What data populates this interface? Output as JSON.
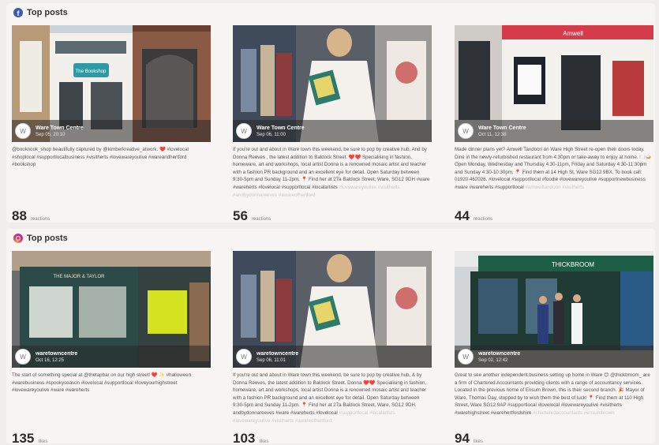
{
  "sections": [
    {
      "title": "Top posts",
      "platform_icon": "facebook-icon",
      "posts": [
        {
          "avatar": "W",
          "account": "Ware Town Centre",
          "date": "Sep 05, 20:10",
          "caption": "@booknook_shop beautifully captured by @kimberkreative_atwork. ❤️ #lovelocal #shoplocal #supportlocalbusiness #visitherts #lovewareyoulive #wareandhertford #bookshop",
          "caption_faded": "",
          "count": "88",
          "unit": "reactions",
          "sign_text": "The Bookshop"
        },
        {
          "avatar": "W",
          "account": "Ware Town Centre",
          "date": "Sep 06, 11:00",
          "caption": "If you're out and about in Ware town this weekend, be sure to pop by creative hub, And by Donna Reeves , the latest addition to Baldock Street. ❤️❤️ Specialising in fashion, homeware, art and workshops, local artist Donna is a renowned mosaic artist and teacher with a fashion PR background and an excellent eye for detail. Open Saturday between 9:30-5pm and Sunday 11-2pm. 📍 Find her at 27a Baldock Street, Ware, SG12 9DH #ware #wareherts #lovelocal #supportlocal #localartists",
          "caption_faded": "#lovewareyoulive #visitherts #andbydonnareeves #awareofhertford",
          "count": "56",
          "unit": "reactions",
          "sign_text": ""
        },
        {
          "avatar": "W",
          "account": "Ware Town Centre",
          "date": "Oct 11, 12:38",
          "caption": "Made dinner plans yet? Amwell Tandoori on Ware High Street re-open their doors today. Dine in the newly-refurbished restaurant from 4:30pm or take-away to enjoy at home. 🍽️🍛 Open Monday, Wednesday and Thursday 4:30-11pm, Friday and Saturday 4:30-11:30pm and Sunday 4:30-10:30pm. 📍 Find them at 14 High St, Ware SG12 9BX. To book call: 01920 462026. #lovelocal #supportlocal #foodie #lovewareyoulive #supportnewbusiness #ware #wareherts #supportlocal",
          "caption_faded": "#amwelltandoori #visitherts",
          "count": "44",
          "unit": "reactions",
          "sign_text": "Amwell"
        }
      ]
    },
    {
      "title": "Top posts",
      "platform_icon": "instagram-icon",
      "posts": [
        {
          "avatar": "W",
          "account": "waretowncentre",
          "date": "Oct 16, 12:25",
          "caption": "The start of something special at @thetapbar on our high street! ❤️ ✨ #halloween #warebusiness #spookyseason #lovelocal #supportlocal #loveyourhighstreet #lovewareyoulive #ware #wareherts",
          "caption_faded": "",
          "count": "135",
          "unit": "likes",
          "sign_text": "THE MAJOR & TAYLOR"
        },
        {
          "avatar": "W",
          "account": "waretowncentre",
          "date": "Sep 06, 11:01",
          "caption": "If you're out and about in Ware town this weekend, be sure to pop by creative hub, & by Donna Reeves, the latest addition to Baldock Street. Donna ❤️❤️ Specialising in fashion, homeware, art and workshops, local artist Donna is a renowned mosaic artist and teacher with a fashion PR background and an excellent eye for detail. Open Saturday between 9:30-5pm and Sunday 11-2pm. 📍 Find her at 27a Baldock Street, Ware, SG12 9DH. andbydonnareeves #ware #wareherts #lovelocal",
          "caption_faded": "#supportlocal #localartists #lovewareyoulive #visitherts #awareofhertford",
          "count": "103",
          "unit": "likes",
          "sign_text": ""
        },
        {
          "avatar": "W",
          "account": "waretowncentre",
          "date": "Sep 02, 12:42",
          "caption": "Great to see another independent business setting up home in Ware 😊 @thickbroom_ are a firm of Chartered Accountants providing clients with a range of accountancy services. Located in the previous home of Ensum Brown, this is their second branch. 🎉 Mayor of Ware, Thomas Day, stopped by to wish them the best of luck! 📍 Find them at 110 High Street, Ware SG12 9AP #supportlocal #lovelocal #lovewareyoulive #visitherts #warehighstreet #warehertfordshire",
          "caption_faded": "#charteredaccountants #ensumbrown",
          "count": "94",
          "unit": "likes",
          "sign_text": "THICKBROOM"
        }
      ]
    }
  ]
}
